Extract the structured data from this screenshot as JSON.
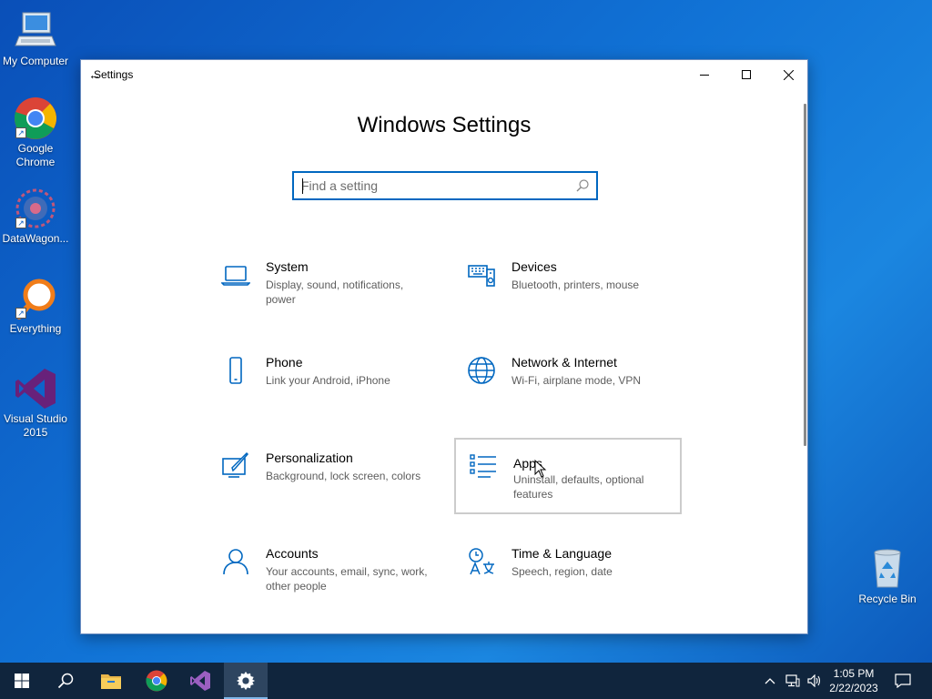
{
  "desktop": {
    "icons": [
      {
        "label": "My Computer"
      },
      {
        "label": "Google Chrome"
      },
      {
        "label": "DataWagon..."
      },
      {
        "label": "Everything"
      },
      {
        "label": "Visual Studio 2015"
      },
      {
        "label": "Recycle Bin"
      }
    ]
  },
  "window": {
    "title": "Settings",
    "heading": "Windows Settings",
    "search_placeholder": "Find a setting",
    "tiles": [
      {
        "name": "System",
        "desc": "Display, sound, notifications, power",
        "icon": "laptop-icon"
      },
      {
        "name": "Devices",
        "desc": "Bluetooth, printers, mouse",
        "icon": "keyboard-speaker-icon"
      },
      {
        "name": "Phone",
        "desc": "Link your Android, iPhone",
        "icon": "phone-icon"
      },
      {
        "name": "Network & Internet",
        "desc": "Wi-Fi, airplane mode, VPN",
        "icon": "globe-icon"
      },
      {
        "name": "Personalization",
        "desc": "Background, lock screen, colors",
        "icon": "paint-brush-icon"
      },
      {
        "name": "Apps",
        "desc": "Uninstall, defaults, optional features",
        "icon": "apps-list-icon"
      },
      {
        "name": "Accounts",
        "desc": "Your accounts, email, sync, work, other people",
        "icon": "person-icon"
      },
      {
        "name": "Time & Language",
        "desc": "Speech, region, date",
        "icon": "time-language-icon"
      }
    ],
    "hovered_tile": "Apps",
    "accent_color": "#0067c0"
  },
  "taskbar": {
    "time": "1:05 PM",
    "date": "2/22/2023",
    "background": "#10253d"
  }
}
